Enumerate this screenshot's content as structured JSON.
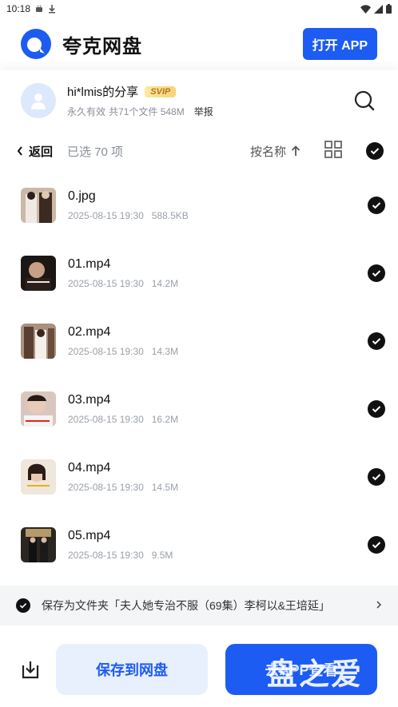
{
  "status_bar": {
    "time": "10:18"
  },
  "header": {
    "app_name": "夸克网盘",
    "open_app_label": "打开 APP"
  },
  "share": {
    "title": "hi*lmis的分享",
    "badge": "SVIP",
    "validity": "永久有效",
    "summary": "共71个文件 548M",
    "report_label": "举报"
  },
  "toolbar": {
    "back_label": "返回",
    "selected_label": "已选 70 项",
    "sort_label": "按名称"
  },
  "files": [
    {
      "name": "0.jpg",
      "date": "2025-08-15 19:30",
      "size": "588.5KB"
    },
    {
      "name": "01.mp4",
      "date": "2025-08-15 19:30",
      "size": "14.2M"
    },
    {
      "name": "02.mp4",
      "date": "2025-08-15 19:30",
      "size": "14.3M"
    },
    {
      "name": "03.mp4",
      "date": "2025-08-15 19:30",
      "size": "16.2M"
    },
    {
      "name": "04.mp4",
      "date": "2025-08-15 19:30",
      "size": "14.5M"
    },
    {
      "name": "05.mp4",
      "date": "2025-08-15 19:30",
      "size": "9.5M"
    }
  ],
  "save_folder": {
    "text": "保存为文件夹「夫人她专治不服（69集）李柯以&王培延」"
  },
  "bottom": {
    "save_label": "保存到网盘",
    "go_app_label": "去APP查看",
    "watermark": "盘之爱"
  },
  "colors": {
    "accent": "#1d5cf2",
    "check": "#111111"
  }
}
